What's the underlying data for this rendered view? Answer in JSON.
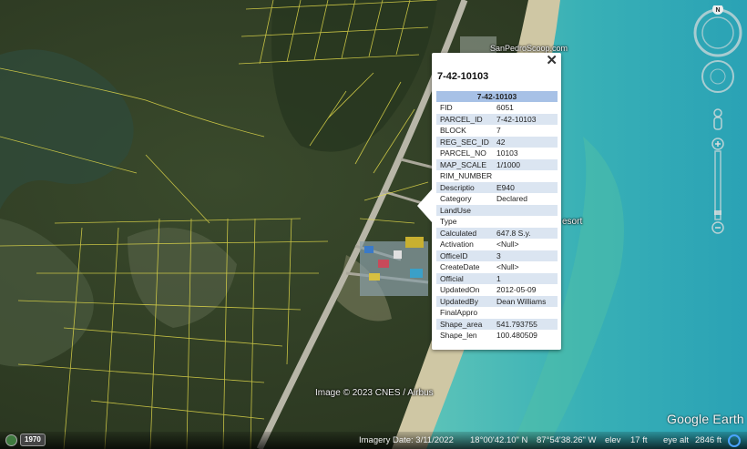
{
  "map": {
    "watermark_url": "SanPedroScoop.com",
    "resort_label": "esort",
    "imagery_credit": "Image © 2023 CNES / Airbus",
    "brand": "Google Earth",
    "compass_label": "N",
    "colors": {
      "parcel_lines": "#e0d84a",
      "water": "#3fb3b4",
      "vegetation": "#35452a"
    }
  },
  "popup": {
    "title": "7-42-10103",
    "header": "7-42-10103",
    "close_label": "✕",
    "rows": [
      {
        "key": "FID",
        "value": "6051"
      },
      {
        "key": "PARCEL_ID",
        "value": "7-42-10103"
      },
      {
        "key": "BLOCK",
        "value": "7"
      },
      {
        "key": "REG_SEC_ID",
        "value": "42"
      },
      {
        "key": "PARCEL_NO",
        "value": "10103"
      },
      {
        "key": "MAP_SCALE",
        "value": "1/1000"
      },
      {
        "key": "RIM_NUMBER",
        "value": ""
      },
      {
        "key": "Descriptio",
        "value": "E940"
      },
      {
        "key": "Category",
        "value": "Declared"
      },
      {
        "key": "LandUse",
        "value": ""
      },
      {
        "key": "Type",
        "value": ""
      },
      {
        "key": "Calculated",
        "value": "647.8 S.y."
      },
      {
        "key": "Activation",
        "value": "<Null>"
      },
      {
        "key": "OfficeID",
        "value": "3"
      },
      {
        "key": "CreateDate",
        "value": "<Null>"
      },
      {
        "key": "Official",
        "value": "1"
      },
      {
        "key": "UpdatedOn",
        "value": "2012-05-09"
      },
      {
        "key": "UpdatedBy",
        "value": "Dean Williams"
      },
      {
        "key": "FinalAppro",
        "value": ""
      },
      {
        "key": "Shape_area",
        "value": "541.793755"
      },
      {
        "key": "Shape_len",
        "value": "100.480509"
      }
    ]
  },
  "statusbar": {
    "year": "1970",
    "imagery_date": "Imagery Date: 3/11/2022",
    "latitude": "18°00'42.10\" N",
    "longitude": "87°54'38.26\" W",
    "elev_label": "elev",
    "elev_value": "17 ft",
    "eye_alt_label": "eye alt",
    "eye_alt_value": "2846 ft"
  }
}
